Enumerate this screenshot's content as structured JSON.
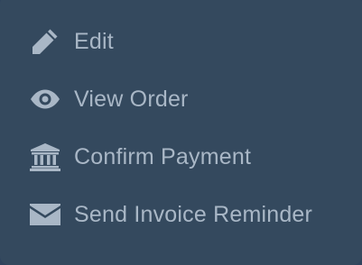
{
  "menu": {
    "items": [
      {
        "label": "Edit",
        "icon": "pencil-icon"
      },
      {
        "label": "View Order",
        "icon": "eye-icon"
      },
      {
        "label": "Confirm Payment",
        "icon": "bank-icon"
      },
      {
        "label": "Send Invoice Reminder",
        "icon": "envelope-icon"
      }
    ]
  },
  "colors": {
    "background": "#34495e",
    "text": "#a9b7c6",
    "icon": "#a9b7c6"
  }
}
